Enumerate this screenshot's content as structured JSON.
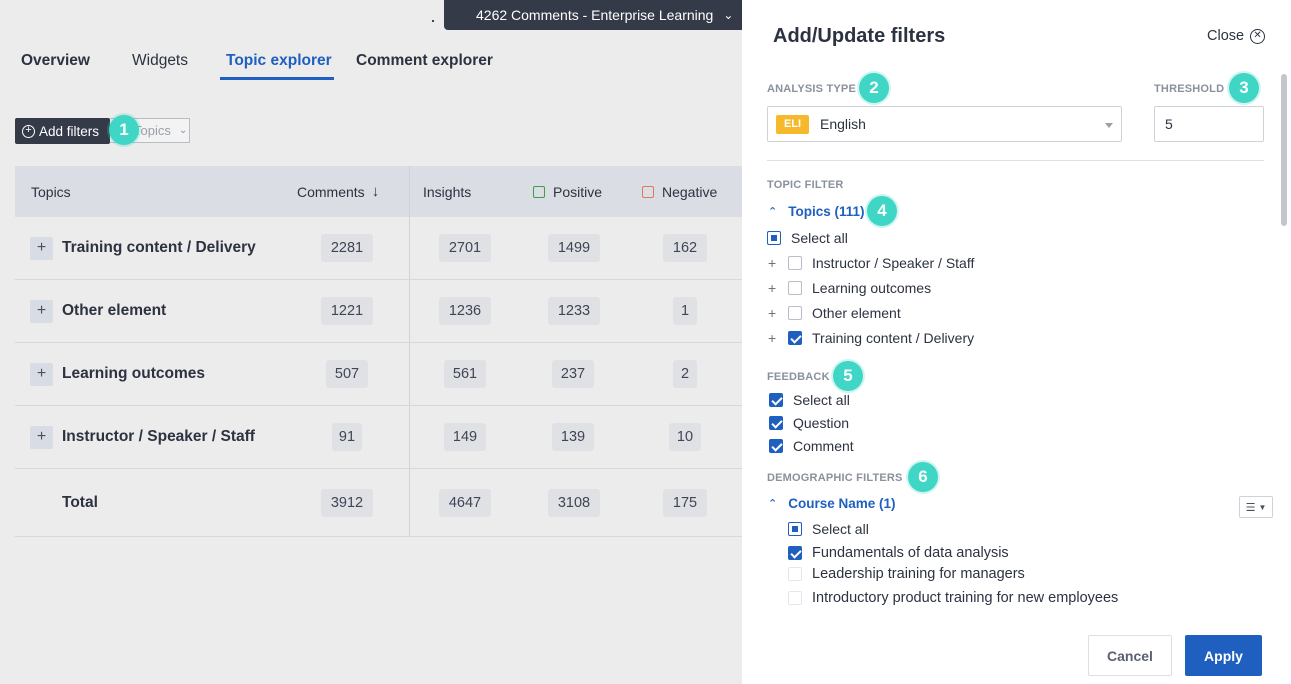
{
  "header": {
    "dataset_label": "4262 Comments - Enterprise Learning"
  },
  "tabs": [
    {
      "label": "Overview"
    },
    {
      "label": "Widgets"
    },
    {
      "label": "Topic explorer",
      "active": true
    },
    {
      "label": "Comment explorer"
    }
  ],
  "toolbar": {
    "add_filters_label": "Add filters",
    "topics_select_label": "Topics"
  },
  "grid": {
    "headers": {
      "topics": "Topics",
      "comments": "Comments",
      "insights": "Insights",
      "positive": "Positive",
      "negative": "Negative"
    },
    "rows": [
      {
        "topic": "Training content / Delivery",
        "comments": "2281",
        "insights": "2701",
        "positive": "1499",
        "negative": "162"
      },
      {
        "topic": "Other element",
        "comments": "1221",
        "insights": "1236",
        "positive": "1233",
        "negative": "1"
      },
      {
        "topic": "Learning outcomes",
        "comments": "507",
        "insights": "561",
        "positive": "237",
        "negative": "2"
      },
      {
        "topic": "Instructor / Speaker / Staff",
        "comments": "91",
        "insights": "149",
        "positive": "139",
        "negative": "10"
      }
    ],
    "total": {
      "label": "Total",
      "comments": "3912",
      "insights": "4647",
      "positive": "3108",
      "negative": "175"
    }
  },
  "panel": {
    "title": "Add/Update filters",
    "close_label": "Close",
    "analysis_type_label": "ANALYSIS TYPE",
    "language_code": "ELI",
    "language_name": "English",
    "threshold_label": "THRESHOLD",
    "threshold_value": "5",
    "topic_filter_label": "TOPIC FILTER",
    "topics_toggle": "Topics (111)",
    "topics_select_all": "Select all",
    "topics": [
      {
        "label": "Instructor / Speaker / Staff",
        "checked": false
      },
      {
        "label": "Learning outcomes",
        "checked": false
      },
      {
        "label": "Other element",
        "checked": false
      },
      {
        "label": "Training content / Delivery",
        "checked": true
      }
    ],
    "feedback_label": "FEEDBACK",
    "feedback": [
      {
        "label": "Select all",
        "checked": true
      },
      {
        "label": "Question",
        "checked": true
      },
      {
        "label": "Comment",
        "checked": true
      }
    ],
    "demographic_label": "DEMOGRAPHIC FILTERS",
    "course_toggle": "Course Name (1)",
    "courses_select_all": "Select all",
    "courses": [
      {
        "label": "Fundamentals of data analysis",
        "checked": true
      },
      {
        "label": "Leadership training for managers",
        "checked": false
      },
      {
        "label": "Introductory product training for new employees",
        "checked": false
      }
    ],
    "cancel_label": "Cancel",
    "apply_label": "Apply"
  },
  "callouts": [
    "1",
    "2",
    "3",
    "4",
    "5",
    "6"
  ],
  "colors": {
    "accent": "#1f5fbf",
    "dark": "#343a48",
    "callout": "#40d6c5",
    "lang_badge": "#f6b92b"
  }
}
